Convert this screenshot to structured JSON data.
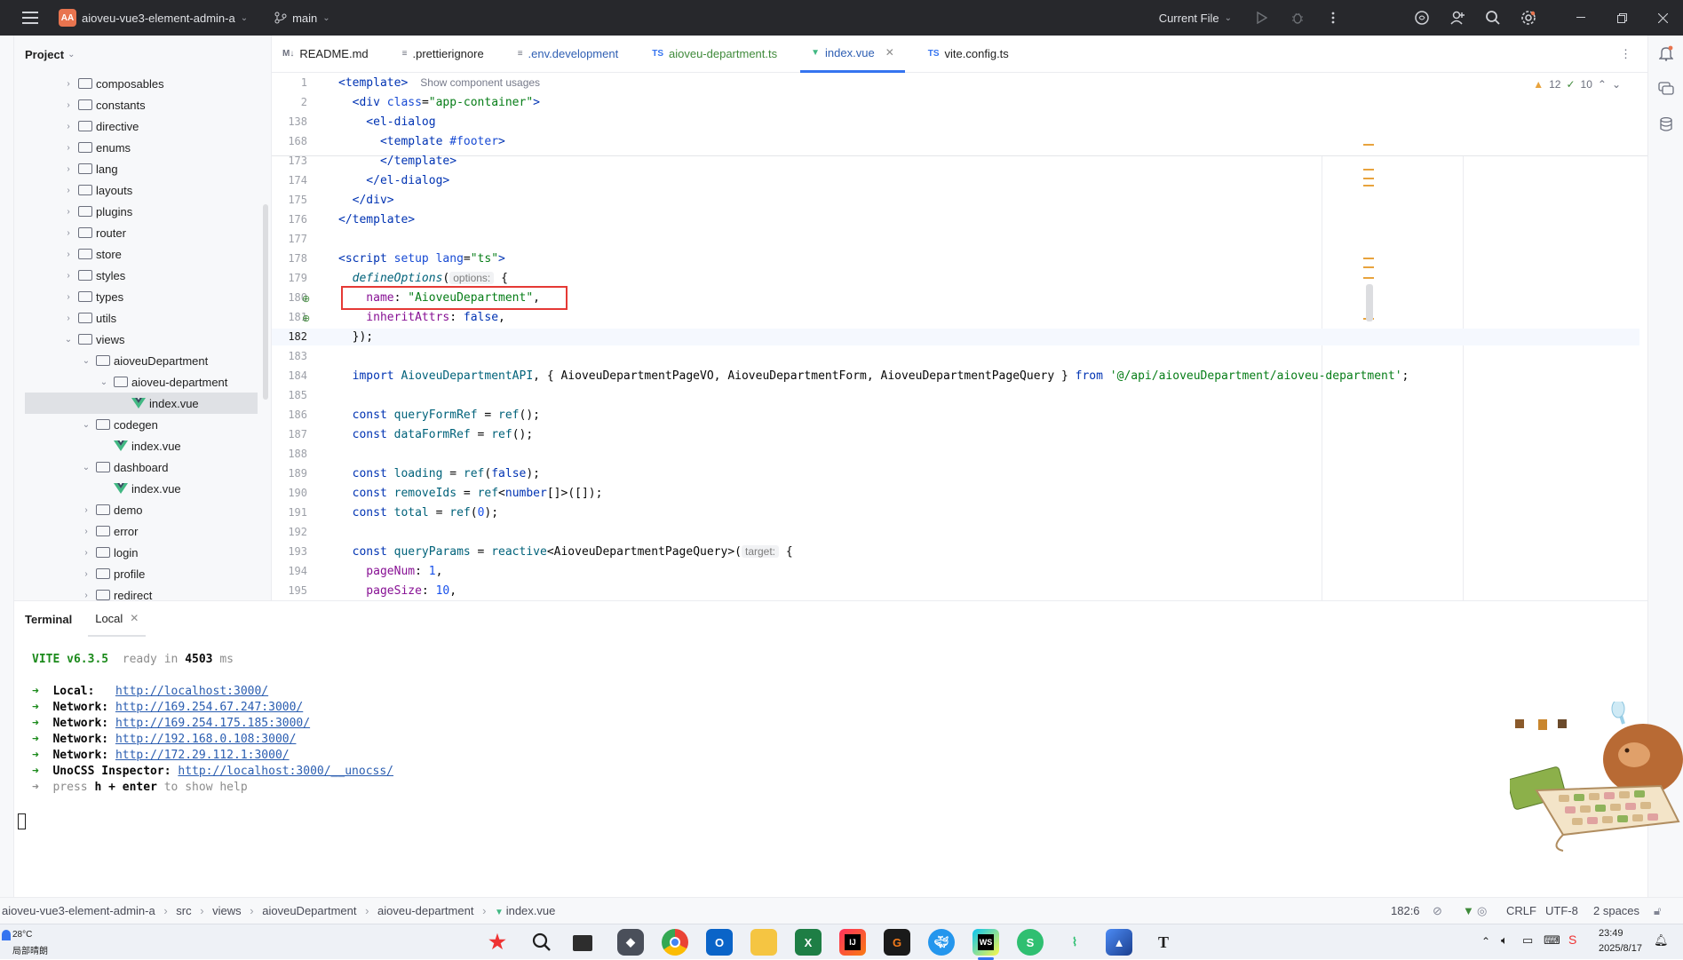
{
  "titlebar": {
    "project_badge": "AA",
    "project_name": "aioveu-vue3-element-admin-a",
    "branch": "main",
    "run_config": "Current File"
  },
  "project_panel": {
    "title": "Project",
    "tree": [
      {
        "label": "composables",
        "kind": "folder",
        "level": 0,
        "expanded": false
      },
      {
        "label": "constants",
        "kind": "folder",
        "level": 0,
        "expanded": false
      },
      {
        "label": "directive",
        "kind": "folder",
        "level": 0,
        "expanded": false
      },
      {
        "label": "enums",
        "kind": "folder",
        "level": 0,
        "expanded": false
      },
      {
        "label": "lang",
        "kind": "folder",
        "level": 0,
        "expanded": false
      },
      {
        "label": "layouts",
        "kind": "folder",
        "level": 0,
        "expanded": false
      },
      {
        "label": "plugins",
        "kind": "folder",
        "level": 0,
        "expanded": false
      },
      {
        "label": "router",
        "kind": "folder",
        "level": 0,
        "expanded": false
      },
      {
        "label": "store",
        "kind": "folder",
        "level": 0,
        "expanded": false
      },
      {
        "label": "styles",
        "kind": "folder",
        "level": 0,
        "expanded": false
      },
      {
        "label": "types",
        "kind": "folder",
        "level": 0,
        "expanded": false
      },
      {
        "label": "utils",
        "kind": "folder",
        "level": 0,
        "expanded": false
      },
      {
        "label": "views",
        "kind": "folder",
        "level": 0,
        "expanded": true
      },
      {
        "label": "aioveuDepartment",
        "kind": "folder",
        "level": 1,
        "expanded": true
      },
      {
        "label": "aioveu-department",
        "kind": "folder",
        "level": 2,
        "expanded": true
      },
      {
        "label": "index.vue",
        "kind": "vue",
        "level": 3,
        "selected": true
      },
      {
        "label": "codegen",
        "kind": "folder",
        "level": 1,
        "expanded": true
      },
      {
        "label": "index.vue",
        "kind": "vue",
        "level": 2
      },
      {
        "label": "dashboard",
        "kind": "folder",
        "level": 1,
        "expanded": true
      },
      {
        "label": "index.vue",
        "kind": "vue",
        "level": 2
      },
      {
        "label": "demo",
        "kind": "folder",
        "level": 1,
        "expanded": false
      },
      {
        "label": "error",
        "kind": "folder",
        "level": 1,
        "expanded": false
      },
      {
        "label": "login",
        "kind": "folder",
        "level": 1,
        "expanded": false
      },
      {
        "label": "profile",
        "kind": "folder",
        "level": 1,
        "expanded": false
      },
      {
        "label": "redirect",
        "kind": "folder",
        "level": 1,
        "expanded": false
      }
    ]
  },
  "tabs": [
    {
      "icon": "M↓",
      "label": "README.md",
      "style": "normal"
    },
    {
      "icon": "≡",
      "label": ".prettierignore",
      "style": "normal"
    },
    {
      "icon": "≡",
      "label": ".env.development",
      "style": "blue"
    },
    {
      "icon": "TS",
      "label": "aioveu-department.ts",
      "style": "green"
    },
    {
      "icon": "▼",
      "label": "index.vue",
      "style": "blue",
      "active": true
    },
    {
      "icon": "TS",
      "label": "vite.config.ts",
      "style": "normal"
    }
  ],
  "editor": {
    "warnings": "12",
    "checks": "10",
    "usage_hint": "Show component usages",
    "hint_options": "options:",
    "hint_target": "target:",
    "line_numbers": [
      "1",
      "2",
      "138",
      "168",
      "173",
      "174",
      "175",
      "176",
      "177",
      "178",
      "179",
      "180",
      "181",
      "182",
      "183",
      "184",
      "185",
      "186",
      "187",
      "188",
      "189",
      "190",
      "191",
      "192",
      "193",
      "194",
      "195"
    ],
    "lines": {
      "l1": "<template>",
      "l2_a": "  <div ",
      "l2_attr": "class",
      "l2_b": "=",
      "l2_str": "\"app-container\"",
      "l2_c": ">",
      "l138": "    <el-dialog",
      "l168_a": "      <template ",
      "l168_b": "#footer",
      "l168_c": ">",
      "l173": "      </template>",
      "l174": "    </el-dialog>",
      "l175": "  </div>",
      "l176": "</template>",
      "l178_a": "<script ",
      "l178_b": "setup ",
      "l178_c": "lang",
      "l178_d": "=",
      "l178_str": "\"ts\"",
      "l178_e": ">",
      "l179_a": "  ",
      "l179_fn": "defineOptions",
      "l179_b": "(",
      "l179_c": " {",
      "l180_prop": "    name",
      "l180_b": ": ",
      "l180_str": "\"AioveuDepartment\"",
      "l180_c": ",",
      "l181_prop": "    inheritAttrs",
      "l181_b": ": ",
      "l181_kw": "false",
      "l181_c": ",",
      "l182": "  });",
      "l184_kw": "  import ",
      "l184_fn": "AioveuDepartmentAPI",
      "l184_b": ", { AioveuDepartmentPageVO, AioveuDepartmentForm, AioveuDepartmentPageQuery } ",
      "l184_kw2": "from ",
      "l184_str": "'@/api/aioveuDepartment/aioveu-department'",
      "l184_c": ";",
      "l186_kw": "  const ",
      "l186_vn": "queryFormRef",
      "l186_b": " = ",
      "l186_fn": "ref",
      "l186_c": "();",
      "l187_kw": "  const ",
      "l187_vn": "dataFormRef",
      "l187_b": " = ",
      "l187_fn": "ref",
      "l187_c": "();",
      "l189_kw": "  const ",
      "l189_vn": "loading",
      "l189_b": " = ",
      "l189_fn": "ref",
      "l189_c": "(",
      "l189_kw2": "false",
      "l189_d": ");",
      "l190_kw": "  const ",
      "l190_vn": "removeIds",
      "l190_b": " = ",
      "l190_fn": "ref",
      "l190_c": "<",
      "l190_type": "number",
      "l190_d": "[]>([]);",
      "l191_kw": "  const ",
      "l191_vn": "total",
      "l191_b": " = ",
      "l191_fn": "ref",
      "l191_c": "(",
      "l191_num": "0",
      "l191_d": ");",
      "l193_kw": "  const ",
      "l193_vn": "queryParams",
      "l193_b": " = ",
      "l193_fn": "reactive",
      "l193_c": "<AioveuDepartmentPageQuery>(",
      "l193_d": " {",
      "l194_prop": "    pageNum",
      "l194_b": ": ",
      "l194_num": "1",
      "l194_c": ",",
      "l195_prop": "    pageSize",
      "l195_b": ": ",
      "l195_num": "10",
      "l195_c": ","
    }
  },
  "terminal": {
    "title": "Terminal",
    "tab": "Local",
    "vite": "VITE v6.3.5",
    "ready_a": "  ready in ",
    "ready_ms": "4503",
    "ready_b": " ms",
    "urls": [
      {
        "label": "Local:   ",
        "url": "http://localhost:3000/"
      },
      {
        "label": "Network: ",
        "url": "http://169.254.67.247:3000/"
      },
      {
        "label": "Network: ",
        "url": "http://169.254.175.185:3000/"
      },
      {
        "label": "Network: ",
        "url": "http://192.168.0.108:3000/"
      },
      {
        "label": "Network: ",
        "url": "http://172.29.112.1:3000/"
      },
      {
        "label": "UnoCSS Inspector: ",
        "url": "http://localhost:3000/__unocss/"
      }
    ],
    "help_a": "press ",
    "help_b": "h + enter",
    "help_c": " to show help",
    "arrow": "➜"
  },
  "statusbar": {
    "crumbs": [
      "aioveu-vue3-element-admin-a",
      "src",
      "views",
      "aioveuDepartment",
      "aioveu-department",
      "index.vue"
    ],
    "position": "182:6",
    "line_sep": "CRLF",
    "encoding": "UTF-8",
    "indent": "2 spaces"
  },
  "taskbar": {
    "weather_temp": "28°C",
    "weather_desc": "局部晴朗",
    "time": "23:49",
    "date": "2025/8/17"
  },
  "colors": {
    "accent": "#3574f0",
    "highlight_box": "#e53935",
    "titlebar_bg": "#27282c"
  }
}
